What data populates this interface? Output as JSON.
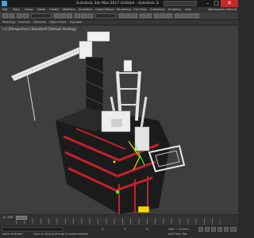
{
  "window": {
    "title": "Autodesk 3ds Max 2017   Untitled - Autodesk 3ds Max",
    "search_placeholder": "",
    "minimize_glyph": "–",
    "maximize_glyph": "□",
    "close_glyph": "✕"
  },
  "menu": {
    "items": [
      "Edit",
      "Tools",
      "Group",
      "Views",
      "Create",
      "Modifiers",
      "Animation",
      "Graph Editors",
      "Rendering",
      "Civil View",
      "Customize",
      "Scripting",
      "Help"
    ],
    "right_label": "Workspaces: Default"
  },
  "ribbon": {
    "tabs": [
      "Modeling",
      "Freeform",
      "Selection",
      "Object Paint",
      "Populate"
    ]
  },
  "viewport": {
    "label": "[+] [Perspective] [Standard] [Default Shading]",
    "icons": [
      "oil-rig-model",
      "crane-boom",
      "helipad",
      "selection-gizmo"
    ]
  },
  "timeline": {
    "frame_label": "0 / 100"
  },
  "status": {
    "selected": "None Selected",
    "prompt": "Click or click-and-drag to select objects",
    "coords": {
      "x": "X:",
      "y": "Y:",
      "z": "Z:"
    },
    "grid": "Grid = 10,0cm",
    "add_time_tag": "Add Time Tag"
  },
  "colors": {
    "accent_close": "#c62828",
    "rig_red": "#c8202a",
    "rig_white": "#e8e8e8",
    "rig_dark": "#1b1b1b",
    "gizmo_yellow": "#ffd400",
    "gizmo_green": "#4cff3a",
    "viewport_bg": "#3e3e3e"
  }
}
